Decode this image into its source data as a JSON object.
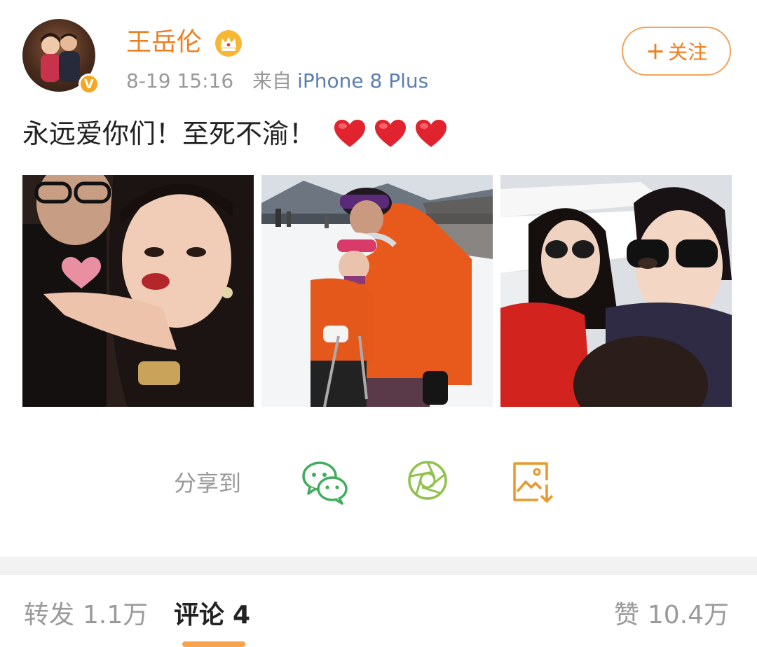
{
  "post": {
    "username": "王岳伦",
    "time": "8-19 15:16",
    "source_prefix": "来自",
    "source": "iPhone 8 Plus",
    "follow_label": "关注",
    "text": "永远爱你们！至死不渝！",
    "badge": "V",
    "heart_count": 3,
    "accent_color": "#f07d1e"
  },
  "share": {
    "label": "分享到",
    "targets": [
      "wechat-icon",
      "moments-icon",
      "save-image-icon"
    ]
  },
  "stats": {
    "repost_label": "转发",
    "repost_count": "1.1万",
    "comment_label": "评论",
    "comment_count": "4",
    "like_label": "赞",
    "like_count": "10.4万"
  }
}
